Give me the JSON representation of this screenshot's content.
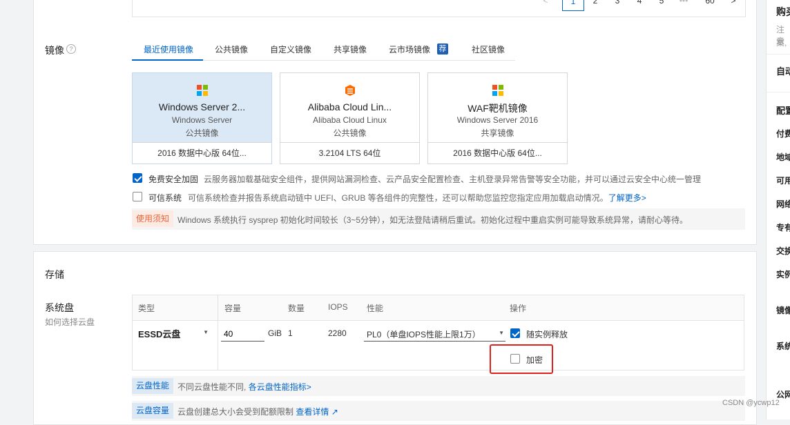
{
  "pagination": {
    "prev": "<",
    "pages": [
      "1",
      "2",
      "3",
      "4",
      "5"
    ],
    "ellipsis": "•••",
    "last": "60",
    "next": ">"
  },
  "image_section": {
    "label": "镜像",
    "help_icon": "?",
    "tabs": [
      "最近使用镜像",
      "公共镜像",
      "自定义镜像",
      "共享镜像",
      "云市场镜像",
      "社区镜像"
    ],
    "recommend_badge": "荐",
    "cards": [
      {
        "name": "Windows Server 2...",
        "os": "Windows Server",
        "type": "公共镜像",
        "version": "2016 数据中心版 64位...",
        "icon": "windows-icon"
      },
      {
        "name": "Alibaba Cloud Lin...",
        "os": "Alibaba Cloud Linux",
        "type": "公共镜像",
        "version": "3.2104 LTS 64位",
        "icon": "alibaba-cloud-icon"
      },
      {
        "name": "WAF靶机镜像",
        "os": "Windows Server 2016",
        "type": "共享镜像",
        "version": "2016 数据中心版 64位...",
        "icon": "windows-icon"
      }
    ],
    "security_label": "免费安全加固",
    "security_desc": "云服务器加载基础安全组件，提供网站漏洞检查、云产品安全配置检查、主机登录异常告警等安全功能，并可以通过云安全中心统一管理",
    "trusted_label": "可信系统",
    "trusted_desc": "可信系统检查并报告系统启动链中 UEFI、GRUB 等各组件的完整性，还可以帮助您监控您指定应用加载启动情况。",
    "learn_more": "了解更多>",
    "notice_tag": "使用须知",
    "notice_text": "Windows 系统执行 sysprep 初始化时间较长（3~5分钟），如无法登陆请稍后重试。初始化过程中重启实例可能导致系统异常，请耐心等待。"
  },
  "storage": {
    "title": "存储",
    "system_disk_label": "系统盘",
    "how_to_choose": "如何选择云盘",
    "headers": [
      "类型",
      "容量",
      "数量",
      "IOPS",
      "性能",
      "操作"
    ],
    "disk_type": "ESSD云盘",
    "capacity": "40",
    "unit": "GiB",
    "quantity": "1",
    "iops": "2280",
    "performance": "PL0（单盘IOPS性能上限1万）",
    "release_label": "随实例释放",
    "encrypt_label": "加密",
    "perf_tag": "云盘性能",
    "perf_text": "不同云盘性能不同,",
    "perf_link": "各云盘性能指标>",
    "cap_tag": "云盘容量",
    "cap_text": "云盘创建总大小会受到配额限制",
    "cap_link": "查看详情"
  },
  "right_panel": {
    "purchase_title": "购买",
    "note_line1": "注意",
    "note_line2": "案,",
    "auto": "自动",
    "config": "配置",
    "items": [
      "付费",
      "地域",
      "可用",
      "网络",
      "专有",
      "交换",
      "实例",
      "镜像",
      "系统",
      "公网"
    ]
  },
  "watermark": "CSDN @ycwp12",
  "colors": {
    "accent": "#0064c8",
    "highlight_box": "#e0201c",
    "notice_tag": "#e8663d",
    "selected_card": "#dbe9f7",
    "page_bg": "#f2f3f5"
  }
}
